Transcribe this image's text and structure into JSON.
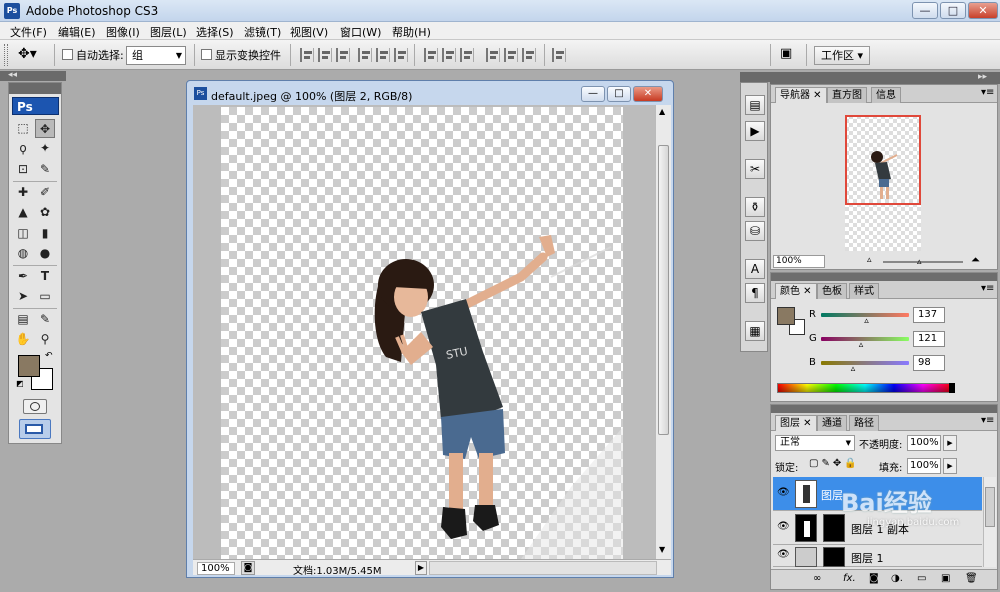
{
  "app": {
    "title": "Adobe Photoshop CS3",
    "logo": "Ps"
  },
  "window_controls": {
    "minimize": "—",
    "maximize": "□",
    "close": "✕"
  },
  "menu": [
    "文件(F)",
    "编辑(E)",
    "图像(I)",
    "图层(L)",
    "选择(S)",
    "滤镜(T)",
    "视图(V)",
    "窗口(W)",
    "帮助(H)"
  ],
  "options_bar": {
    "auto_select_label": "自动选择:",
    "auto_select_value": "组",
    "show_transform_label": "显示变换控件",
    "workspace_label": "工作区 ▾"
  },
  "toolbox": {
    "tools": [
      [
        "⬚",
        "✥"
      ],
      [
        "ϙ",
        "✦"
      ],
      [
        "⊡",
        "✎"
      ],
      [
        "✚",
        "✐"
      ],
      [
        "▲",
        "✿"
      ],
      [
        "◫",
        "▮"
      ],
      [
        "◍",
        "●"
      ],
      [
        "✒",
        "T"
      ],
      [
        "➤",
        "▭"
      ],
      [
        "▤",
        "✎"
      ],
      [
        "✋",
        "⚲"
      ]
    ],
    "fg_color": "#897962",
    "bg_color": "#ffffff"
  },
  "document": {
    "title": "default.jpeg @ 100% (图层 2, RGB/8)",
    "zoom": "100%",
    "doc_info": "文档:1.03M/5.45M"
  },
  "navigator": {
    "tabs": [
      "导航器",
      "直方图",
      "信息"
    ],
    "zoom": "100%"
  },
  "color_panel": {
    "tabs": [
      "颜色",
      "色板",
      "样式"
    ],
    "channels": [
      {
        "name": "R",
        "value": "137",
        "fraction": 0.537
      },
      {
        "name": "G",
        "value": "121",
        "fraction": 0.475
      },
      {
        "name": "B",
        "value": "98",
        "fraction": 0.384
      }
    ]
  },
  "layers_panel": {
    "tabs": [
      "图层",
      "通道",
      "路径"
    ],
    "blend_mode": "正常",
    "opacity_label": "不透明度:",
    "opacity_value": "100%",
    "lock_label": "锁定:",
    "fill_label": "填充:",
    "fill_value": "100%",
    "layers": [
      {
        "name": "图层 ",
        "selected": true
      },
      {
        "name": "图层 1 副本",
        "selected": false
      },
      {
        "name": "图层 1",
        "selected": false
      }
    ],
    "footer_icons": [
      "∞",
      "fx.",
      "◙",
      "◑.",
      "▭",
      "▣",
      "🗑"
    ]
  },
  "watermark": {
    "text": "Bai经验",
    "url": "jingyan.baidu.com"
  }
}
